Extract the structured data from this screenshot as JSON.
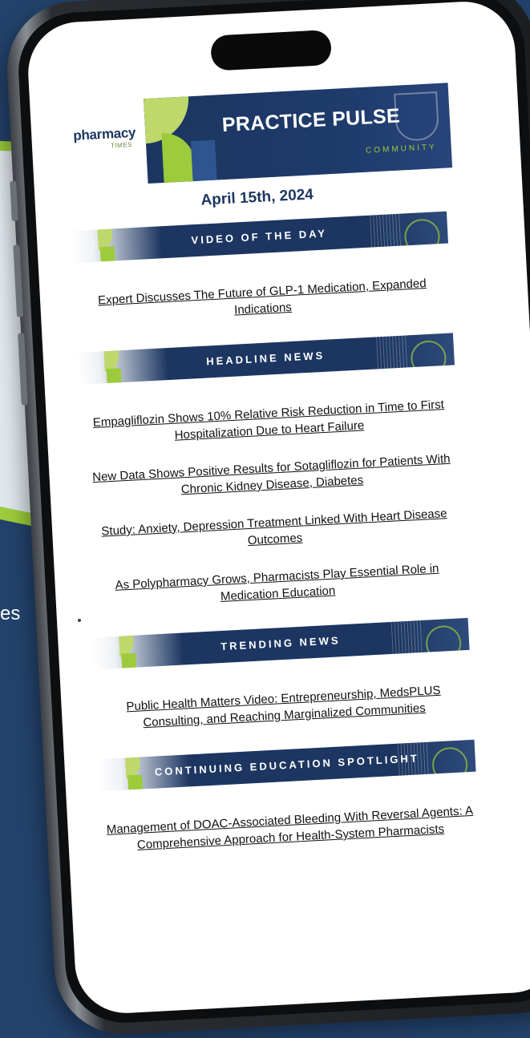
{
  "background": {
    "partial_text": "es",
    "colors": {
      "navy": "#23426b",
      "green": "#9ccb3b",
      "light": "#e9eef2"
    }
  },
  "newsletter": {
    "logo": {
      "brand": "pharmacy",
      "sub": "TIMES"
    },
    "title": "PRACTICE PULSE",
    "subtitle": "COMMUNITY",
    "date": "April 15th, 2024",
    "sections": [
      {
        "title": "VIDEO OF THE DAY",
        "links": [
          "Expert Discusses The Future of GLP-1 Medication, Expanded Indications"
        ]
      },
      {
        "title": "HEADLINE NEWS",
        "links": [
          "Empagliflozin Shows 10% Relative Risk Reduction in Time to First Hospitalization Due to Heart Failure",
          "New Data Shows Positive Results for Sotagliflozin for Patients With Chronic Kidney Disease, Diabetes",
          "Study: Anxiety, Depression Treatment Linked With Heart Disease Outcomes",
          "As Polypharmacy Grows, Pharmacists Play Essential Role in Medication Education"
        ]
      },
      {
        "title": "TRENDING NEWS",
        "links": [
          "Public Health Matters Video: Entrepreneurship, MedsPLUS Consulting, and Reaching Marginalized Communities"
        ]
      },
      {
        "title": "CONTINUING EDUCATION SPOTLIGHT",
        "links": [
          "Management of DOAC-Associated Bleeding With Reversal Agents: A Comprehensive Approach for Health-System Pharmacists"
        ]
      }
    ]
  }
}
